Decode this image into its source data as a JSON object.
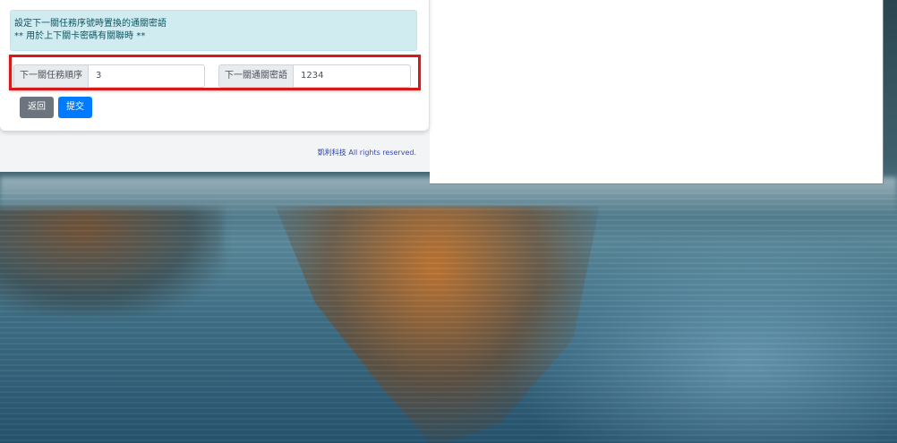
{
  "alert": {
    "line1": "設定下一關任務序號時置換的通關密語",
    "line2": "** 用於上下關卡密碼有關聯時 **"
  },
  "form": {
    "next_task_order_label": "下一關任務順序",
    "next_task_order_value": "3",
    "next_pass_phrase_label": "下一關通關密語",
    "next_pass_phrase_value": "1234"
  },
  "buttons": {
    "back_label": "返回",
    "submit_label": "提交"
  },
  "footer": {
    "brand": "凱利科技",
    "rights": " All rights reserved."
  },
  "colors": {
    "alert_bg": "#d1ecf1",
    "back_button": "#6c757d",
    "submit_button": "#007bff",
    "highlight_border": "#d71919"
  }
}
